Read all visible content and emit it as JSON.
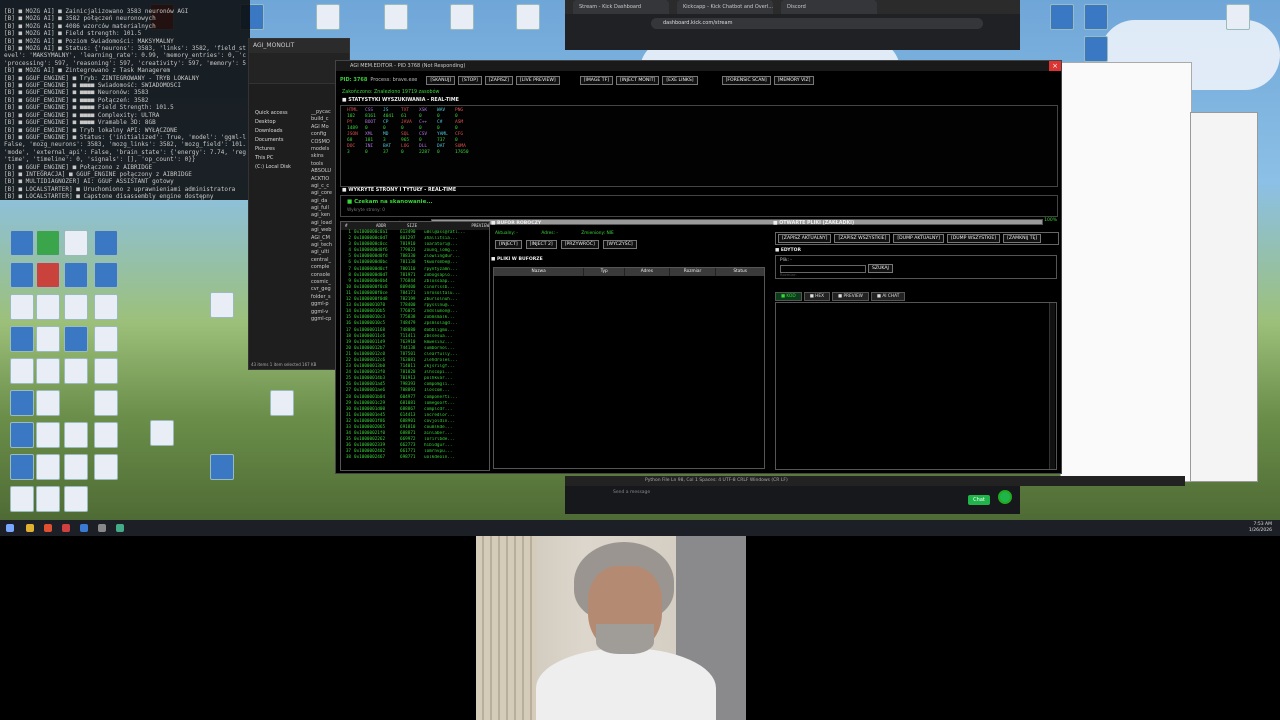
{
  "console": {
    "lines": [
      "[B] ■ MÓZG AI] ■ Zainicjalizowano 3583 neuronów AGI",
      "[B] ■ MÓZG AI] ■ 3582 połączeń neuronowych",
      "[B] ■ MÓZG AI] ■ 4086 wzorców materialnych",
      "[B] ■ MÓZG AI] ■ Field strength: 101.5",
      "[B] ■ MÓZG AI] ■ Poziom Świadomości: MAKSYMALNY",
      "[B] ■ MÓZG AI] ■ Status: {'neurons': 3583, 'links': 3582, 'field_strength': 91...",
      "evel': 'MAKSYMALNY', 'learning_rate': 0.99, 'memory_entries': 0, 'conse...",
      "'processing': 597, 'reasoning': 597, 'creativity': 597, 'memory': 597...",
      "[B] ■ MÓZG AI] ■ Zintegrowano z Task Managerem",
      "[B] ■ GGUF_ENGINE] ■ Tryb: ZINTEGROWANY - TRYB LOKALNY",
      "[B] ■ GGUF_ENGINE] ■ ■■■■ Świadomość: ŚWIADOMOŚCI",
      "[B] ■ GGUF_ENGINE] ■ ■■■■ Neuronów: 3583",
      "[B] ■ GGUF_ENGINE] ■ ■■■■ Połączeń: 3582",
      "[B] ■ GGUF_ENGINE] ■ ■■■■ Field Strength: 101.5",
      "[B] ■ GGUF_ENGINE] ■ ■■■■ Complexity: ULTRA",
      "[B] ■ GGUF_ENGINE] ■ ■■■■ Vramable 3D: 8GB",
      "[B] ■ GGUF_ENGINE] ■ Tryb lokalny API: WYŁĄCZONE",
      "[B] ■ GGUF_ENGINE] ■ Status: {'initialized': True, 'model': 'ggml-local-cpu-hu...",
      "False, 'mozg_neurons': 3583, 'mozg_links': 3582, 'mozg_field': 101.5, 'mod...",
      "'mode', 'external_api': False, 'brain_state': {'energy': 7.74, 'register': 447...",
      "'time', 'timeline': 0, 'signals': [], 'op_count': 0}}",
      "[B] ■ GGUF_ENGINE] ■ Połączono z AIBRIDGE",
      "[B] ■ INTEGRACJA] ■ GGUF_ENGINE połączony z AIBRIDGE",
      "[B] ■ MULTIDIAGNOZER] AI: GGUF ASSISTANT gotowy",
      "[B] ■ LOCALSTARTER] ■ Uruchomiono z uprawnieniami administratora",
      "[B] ■ LOCALSTARTER] ■ Capstone disassembly engine dostępny",
      "[B] ■ AIBRIDGE] ■ ■■■■ Ścieżka modelu: C:\\Users\\Pixel\\Desktop\\MODELS",
      "[B] ■ AIBRIDGE] ■ Załadowano 0 modeli GGUF",
      "[B] ■ AI_CHAT] ■ Zakładka AI CHAT zainicjalizowana!"
    ]
  },
  "explorer": {
    "title": "AGI_MONOLIT",
    "sidebar": [
      "Quick access",
      "Desktop",
      "Downloads",
      "Documents",
      "Pictures",
      "This PC",
      "(C:) Local Disk"
    ],
    "files": [
      "__pycac",
      "build_c",
      "AGI Mo",
      "config",
      "COSMO",
      "models",
      "skins",
      "tools",
      "ABSOLU",
      "ACKTIO",
      "agi_c_c",
      "agi_core",
      "agi_da",
      "agi_full",
      "agi_ken",
      "agi_load",
      "agi_web",
      "AGI_CM",
      "agi_tech",
      "agi_ulti",
      "central_",
      "comple",
      "console",
      "cosmic_",
      "cvr_geg",
      "folder_s",
      "ggml-p",
      "ggml-v",
      "ggml-cp"
    ],
    "status": "43 items   1 item selected  167 KB"
  },
  "browser": {
    "tabs": [
      "Stream - Kick Dashboard",
      "Kickcapp - Kick Chatbot and Overl...",
      "Discord"
    ],
    "url": "dashboard.kick.com/stream"
  },
  "app": {
    "title": "AGI MEM.EDITOR - PID 3768 (Not Responding)",
    "pid": "PID: 3768",
    "process": "Process: brave.exe",
    "toolbar": [
      "[SKANUJ]",
      "[STOP]",
      "[ZAPISZ]",
      "[LIVE PREVIEW]",
      "[IMAGE TF]",
      "[INJECT MONIT]",
      "[EXE LINKS]",
      "[FORENSIC SCAN]",
      "[MEMORY VIZ]"
    ],
    "status_line": "Zakończono: Znaleziono 19719 zasobów",
    "stats_title": "■ STATYSTYKI WYSZUKIWANIA - REAL-TIME",
    "stats_rows": [
      {
        "labels": [
          "HTML",
          "CSS",
          "JS",
          "TXT",
          "XSK",
          "WAV",
          "PNG"
        ],
        "values": [
          "102",
          "8161",
          "4041",
          "61",
          "0",
          "0",
          "0"
        ]
      },
      {
        "labels": [
          "PY",
          "BOOT",
          "CP",
          "JAVA",
          "C++",
          "C#",
          "ASM"
        ],
        "values": [
          "1489",
          "0",
          "0",
          "0",
          "0",
          "0",
          "0"
        ]
      },
      {
        "labels": [
          "JSON",
          "XML",
          "MD",
          "SQL",
          "CSV",
          "YAML",
          "CFG"
        ],
        "values": [
          "68",
          "181",
          "3",
          "965",
          "0",
          "737",
          "0"
        ]
      },
      {
        "labels": [
          "DOC",
          "INI",
          "BAT",
          "LOG",
          "DLL",
          "DAT",
          "SUMA"
        ],
        "values": [
          "3",
          "0",
          "37",
          "0",
          "2287",
          "0",
          "17650"
        ]
      }
    ],
    "scan_done": "■ Skanowanie zakończone!",
    "scan_progress": 1.0,
    "scan_percent": "100%",
    "detect_title": "■ WYKRYTE STRONY I TYTUŁY - REAL-TIME",
    "detect_waiting": "■ Czekam na skanowanie...",
    "detect_sub": "Wykryte strony: 0",
    "mem_headers": [
      "#",
      "ADDR",
      "SIZE",
      "PREVIEW"
    ],
    "mem_rows": [
      {
        "n": "1",
        "a": "0x1000000c0a1",
        "s": "613490",
        "p": "u8sl@ass@ratl..."
      },
      {
        "n": "2",
        "a": "0x1000000c0d7",
        "s": "801297",
        "p": "3hallitsia..."
      },
      {
        "n": "3",
        "a": "0x1000000c0cc",
        "s": "781910",
        "p": "loaratori@..."
      },
      {
        "n": "4",
        "a": "0x1000000d0f6",
        "s": "779023",
        "p": "2ounq_lomg..."
      },
      {
        "n": "5",
        "a": "0x1000000d0fd",
        "s": "788330",
        "p": "2lowlingdur..."
      },
      {
        "n": "6",
        "a": "0x1000000d0bc",
        "s": "781130",
        "p": "tkworsmbe@..."
      },
      {
        "n": "7",
        "a": "0x1000000d0cf",
        "s": "780110",
        "p": "rpyntyzamn..."
      },
      {
        "n": "8",
        "a": "0x1000000d0d7",
        "s": "781971",
        "p": "2obogsaplo..."
      },
      {
        "n": "9",
        "a": "0x1000000e0b4",
        "s": "776844",
        "p": "2blossaap..."
      },
      {
        "n": "10",
        "a": "0x1000000f0c8",
        "s": "809400",
        "p": "cinorlssb..."
      },
      {
        "n": "11",
        "a": "0x1000000f0ce",
        "s": "784171",
        "p": "inrosoltalu..."
      },
      {
        "n": "12",
        "a": "0x1000000f0d8",
        "s": "782199",
        "p": "2burlolnuh..."
      },
      {
        "n": "13",
        "a": "0x1000001070",
        "s": "778400",
        "p": "rpysslnu@..."
      },
      {
        "n": "14",
        "a": "0x10000010b5",
        "s": "776075",
        "p": "2ndslumon@..."
      },
      {
        "n": "15",
        "a": "0x10000010c3",
        "s": "775838",
        "p": "2obmsmalk..."
      },
      {
        "n": "16",
        "a": "0x10000010c5",
        "s": "748479",
        "p": "2psmlolagd..."
      },
      {
        "n": "17",
        "a": "0x1000001168",
        "s": "748080",
        "p": "dobbligmo..."
      },
      {
        "n": "18",
        "a": "0x10000011c6",
        "s": "711411",
        "p": "2bssesua..."
      },
      {
        "n": "19",
        "a": "0x10000011d9",
        "s": "763910",
        "p": "kmwesin2..."
      },
      {
        "n": "20",
        "a": "0x10000012b7",
        "s": "744138",
        "p": "sumbornol..."
      },
      {
        "n": "21",
        "a": "0x10000012c0",
        "s": "787501",
        "p": "clearfully..."
      },
      {
        "n": "22",
        "a": "0x10000012c6",
        "s": "763081",
        "p": "2lehdroles..."
      },
      {
        "n": "23",
        "a": "0x10000013b0",
        "s": "714011",
        "p": "2kjsrilgf..."
      },
      {
        "n": "24",
        "a": "0x10000013f0",
        "s": "781820",
        "p": "3lhscopi..."
      },
      {
        "n": "25",
        "a": "0x10000014b3",
        "s": "701913",
        "p": "polhkvar..."
      },
      {
        "n": "26",
        "a": "0x1000001ad5",
        "s": "798393",
        "p": "compomgli..."
      },
      {
        "n": "27",
        "a": "0x1000001ae6",
        "s": "708893",
        "p": "1loscom..."
      },
      {
        "n": "28",
        "a": "0x1000001b04",
        "s": "604977",
        "p": "componerti..."
      },
      {
        "n": "29",
        "a": "0x1000001c29",
        "s": "681081",
        "p": "lomegoort..."
      },
      {
        "n": "30",
        "a": "0x1000001d00",
        "s": "688867",
        "p": "complcdr..."
      },
      {
        "n": "31",
        "a": "0x1000001e45",
        "s": "614413",
        "p": "incredlor..."
      },
      {
        "n": "32",
        "a": "0x1000001f86",
        "s": "688901",
        "p": "covjoldin..."
      },
      {
        "n": "33",
        "a": "0x1000002065",
        "s": "691810",
        "p": "coumlkde..."
      },
      {
        "n": "34",
        "a": "0x10000021f0",
        "s": "688871",
        "p": "ainlaber..."
      },
      {
        "n": "35",
        "a": "0x1000002262",
        "s": "669972",
        "p": "lorirlbde..."
      },
      {
        "n": "36",
        "a": "0x1000002339",
        "s": "662773",
        "p": "hibidgur..."
      },
      {
        "n": "37",
        "a": "0x1000002402",
        "s": "661771",
        "p": "lomrnvpu..."
      },
      {
        "n": "38",
        "a": "0x1000002467",
        "s": "698771",
        "p": "uolkdeoin..."
      }
    ],
    "buffer": {
      "title": "■ BUFOR ROBOCZY",
      "stats": [
        "Aktualny: -",
        "Adres: -",
        "Zmieniony: NIE"
      ],
      "buttons": [
        "[INJECT]",
        "[INJECT 2]",
        "[PRZYWRÓĆ]",
        "[WYCZYŚĆ]"
      ],
      "files_title": "■ PLIKI W BUFORZE",
      "columns": [
        "Nazwa",
        "Typ",
        "Adres",
        "Rozmiar",
        "Status"
      ]
    },
    "open_files": {
      "title": "■ OTWARTE PLIKI (ZAKŁADKI)",
      "buttons": [
        "[ZAPISZ AKTUALNY]",
        "[ZAPISZ WSZYSTKIE]",
        "[DUMP AKTUALNY]",
        "[DUMP WSZYSTKIE]",
        "[ZAMKNIJ TĘ]"
      ],
      "editor_label": "■ EDYTOR",
      "file_label": "Plik: -",
      "size_label": "Rozmiar:",
      "search_btn": "SZUKAJ",
      "tabs": [
        "■ KOD",
        "■ HEX",
        "■ PREVIEW",
        "■ AI CHAT"
      ]
    }
  },
  "ide_status": "Python File   Ln 98, Col 1   Spaces: 4   UTF-8   CRLF   Windows (CR LF)",
  "chat": {
    "placeholder": "Send a message",
    "button": "Chat"
  },
  "taskbar": {
    "time": "7:53 AM",
    "date": "1/26/2026"
  }
}
